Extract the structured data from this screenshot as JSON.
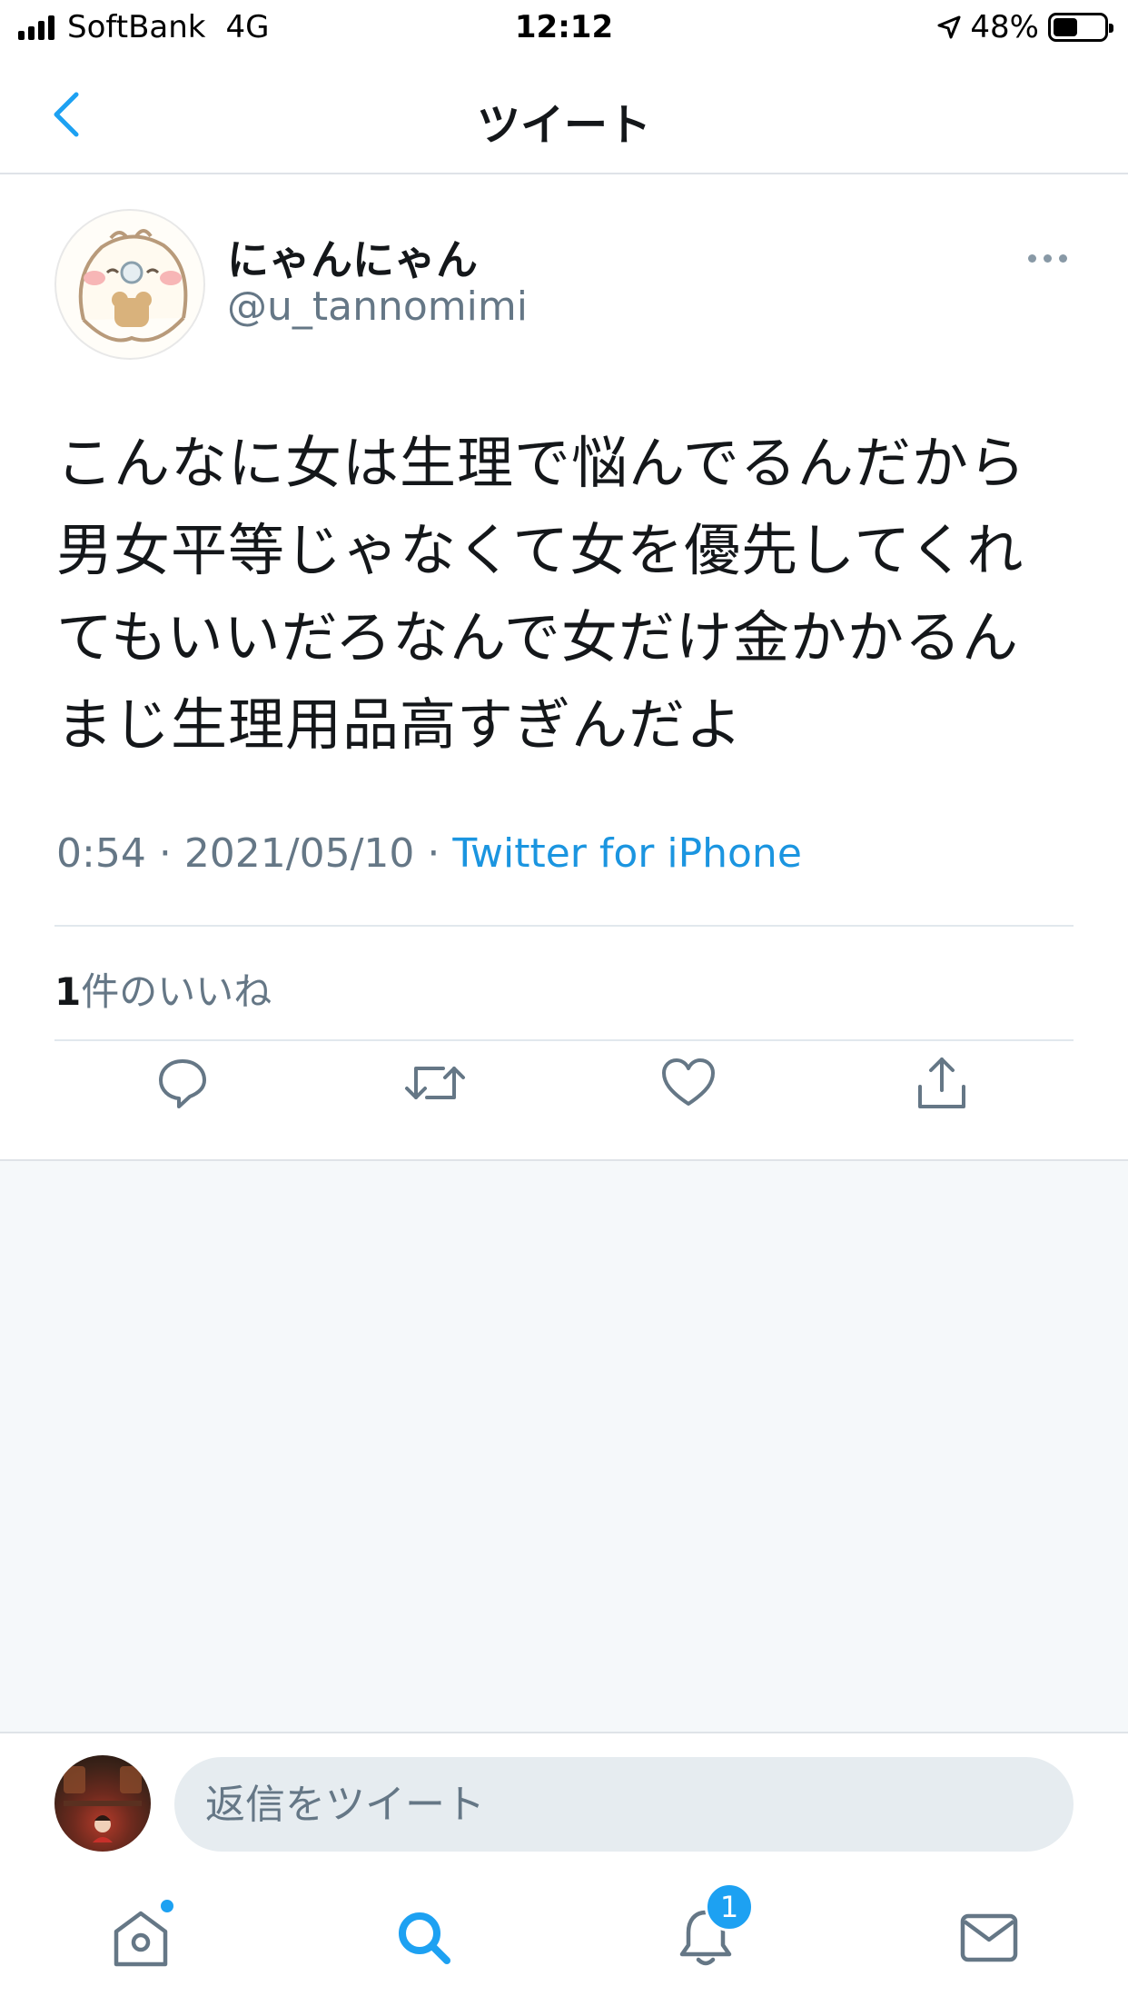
{
  "status_bar": {
    "carrier": "SoftBank",
    "network": "4G",
    "time": "12:12",
    "battery_percent": "48%",
    "battery_level": 0.48
  },
  "nav": {
    "title": "ツイート",
    "back_icon": "chevron-left-icon"
  },
  "tweet": {
    "display_name": "にゃんにゃん",
    "handle": "@u_tannomimi",
    "text_lines": [
      "こんなに女は生理で悩んでるんだから",
      "男女平等じゃなくて女を優先してくれ",
      "てもいいだろなんで女だけ金かかるん",
      "まじ生理用品高すぎんだよ"
    ],
    "time": "0:54",
    "separator": "·",
    "date": "2021/05/10",
    "source": "Twitter for iPhone",
    "likes_count": "1",
    "likes_label": "件のいいね"
  },
  "actions": {
    "reply_icon": "reply-icon",
    "retweet_icon": "retweet-icon",
    "like_icon": "heart-icon",
    "share_icon": "share-icon"
  },
  "reply_bar": {
    "placeholder": "返信をツイート"
  },
  "tab_bar": {
    "notifications_badge": "1",
    "items": [
      "home-icon",
      "search-icon",
      "bell-icon",
      "mail-icon"
    ]
  },
  "colors": {
    "accent": "#1da1f2",
    "link": "#1b95e0",
    "text_primary": "#14171a",
    "text_secondary": "#657786",
    "background_gray": "#f5f8fa"
  }
}
